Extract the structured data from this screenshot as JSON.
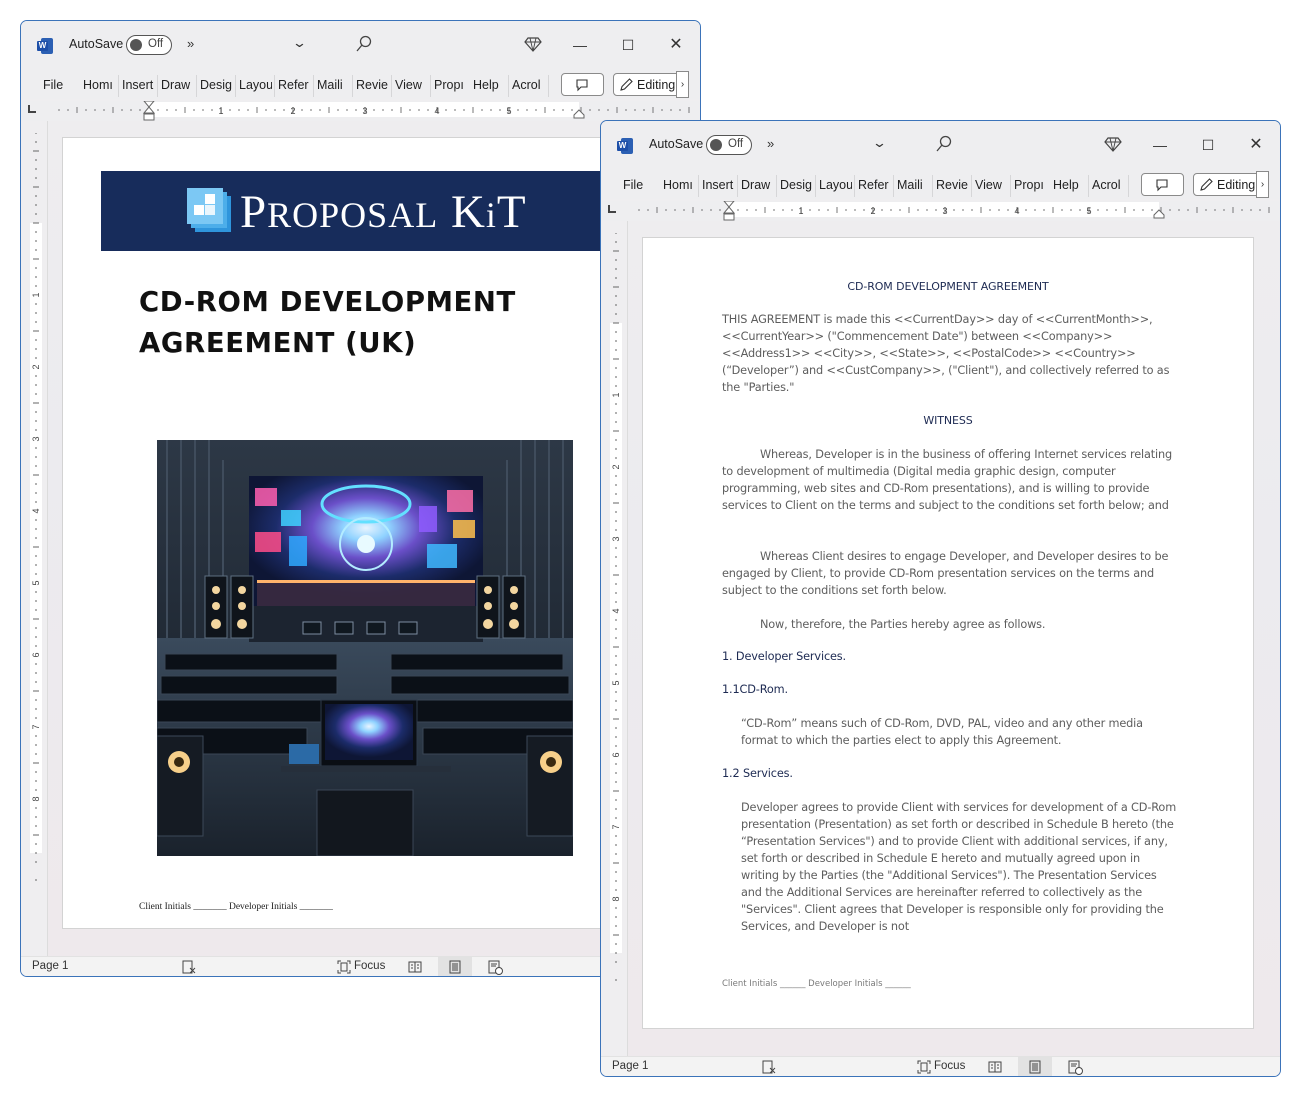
{
  "windows": [
    {
      "id": "cover",
      "titlebar": {
        "app_icon": "word-icon",
        "autosave_label": "AutoSave",
        "autosave_state": "Off",
        "more_commands": "»",
        "chevron": "⌄",
        "search_icon": "search-icon",
        "premium_icon": "diamond-icon",
        "minimize": "—",
        "maximize": "☐",
        "close": "✕"
      },
      "ribbon": {
        "tabs": [
          "File",
          "Homı",
          "Insert",
          "Draw",
          "Desig",
          "Layou",
          "Refer",
          "Maili",
          "Revie",
          "View",
          "Propı",
          "Help",
          "Acrol"
        ],
        "comment_icon": "comment-icon",
        "editing_label": "Editing",
        "editing_more": "›"
      },
      "ruler_numbers": [
        "1",
        "2",
        "3",
        "4",
        "5"
      ],
      "vruler_numbers": [
        "1",
        "2",
        "3",
        "4",
        "5",
        "6",
        "7",
        "8"
      ],
      "page": {
        "brand": {
          "name_big_P": "P",
          "name_rest1": "ROPOSAL",
          "name_big_K": "K",
          "name_rest2": "i",
          "name_big_T": "T"
        },
        "title": "CD-ROM DEVELOPMENT AGREEMENT (UK)",
        "image_alt": "Presentation theater with large multimedia screen, speakers, seats and computer desk",
        "footer": "Client Initials  _______ Developer Initials _______"
      },
      "statusbar": {
        "page": "Page 1",
        "focus_label": "Focus"
      }
    },
    {
      "id": "agreement",
      "titlebar": {
        "app_icon": "word-icon",
        "autosave_label": "AutoSave",
        "autosave_state": "Off",
        "more_commands": "»",
        "chevron": "⌄",
        "search_icon": "search-icon",
        "premium_icon": "diamond-icon",
        "minimize": "—",
        "maximize": "☐",
        "close": "✕"
      },
      "ribbon": {
        "tabs": [
          "File",
          "Homı",
          "Insert",
          "Draw",
          "Desig",
          "Layou",
          "Refer",
          "Maili",
          "Revie",
          "View",
          "Propı",
          "Help",
          "Acrol"
        ],
        "comment_icon": "comment-icon",
        "editing_label": "Editing",
        "editing_more": "›"
      },
      "ruler_numbers": [
        "1",
        "2",
        "3",
        "4",
        "5"
      ],
      "vruler_numbers": [
        "1",
        "2",
        "3",
        "4",
        "5",
        "6",
        "7",
        "8"
      ],
      "page": {
        "heading": "CD-ROM DEVELOPMENT AGREEMENT",
        "intro": "THIS AGREEMENT is made this <<CurrentDay>> day of <<CurrentMonth>>, <<CurrentYear>> (\"Commencement Date\") between <<Company>> <<Address1>> <<City>>, <<State>>, <<PostalCode>> <<Country>> (“Developer”) and <<CustCompany>>, (\"Client\"), and collectively referred to as the \"Parties.\"",
        "witness": "WITNESS",
        "whereas1": "Whereas, Developer is in the business of offering Internet services relating to development of multimedia (Digital media graphic design, computer programming, web sites and CD-Rom presentations), and is willing to provide services to Client on the terms and subject to the conditions set forth below; and",
        "whereas2": "Whereas Client desires to engage Developer, and Developer desires to be engaged by Client, to provide CD-Rom presentation services on the terms and subject to the conditions set forth below.",
        "now_therefore": "Now, therefore, the Parties hereby agree as follows.",
        "section1": "1. Developer Services.",
        "section1_1": "1.1CD-Rom.",
        "section1_1_text": "“CD-Rom” means such of CD-Rom, DVD, PAL, video and any other media format to which the parties elect to apply this Agreement.",
        "section1_2": "1.2 Services.",
        "section1_2_text": "Developer agrees  to provide Client with services for development of a CD-Rom presentation (Presentation) as set forth or described in Schedule B hereto   (the “Presentation Services\") and to provide Client with additional services, if any, set forth or described in Schedule E hereto and mutually agreed upon in writing by the Parties (the \"Additional Services\"). The Presentation Services and the Additional Services are hereinafter referred to collectively as the \"Services\". Client agrees that Developer is responsible only for providing the Services, and Developer is not",
        "footer": "Client Initials  ______ Developer Initials ______"
      },
      "statusbar": {
        "page": "Page 1",
        "focus_label": "Focus"
      }
    }
  ],
  "colors": {
    "window_border": "#3b73b9",
    "banner_navy": "#172c5b",
    "logo_blue": "#6cc3f2",
    "heading_navy": "#1d2a52",
    "body_gray": "#5d5d5d"
  }
}
